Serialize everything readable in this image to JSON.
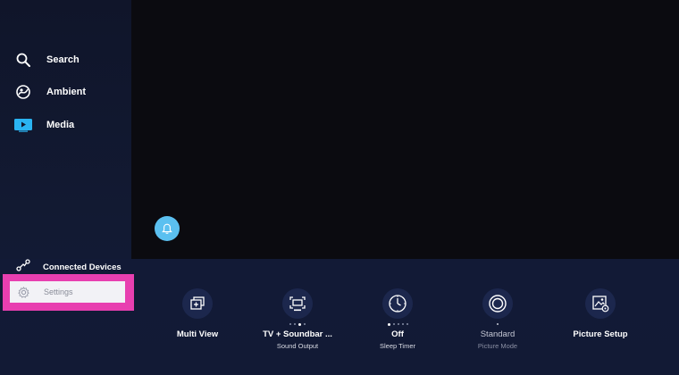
{
  "sidebar": {
    "items": [
      {
        "label": "Search",
        "icon": "search-icon"
      },
      {
        "label": "Ambient",
        "icon": "ambient-icon"
      },
      {
        "label": "Media",
        "icon": "media-icon"
      }
    ],
    "connected_devices": {
      "label": "Connected Devices",
      "icon": "connected-devices-icon"
    },
    "settings": {
      "label": "Settings",
      "icon": "gear-icon",
      "highlight_color": "#e83fb0"
    }
  },
  "notification": {
    "icon": "bell-icon",
    "color": "#5bc0f0"
  },
  "quick_settings": [
    {
      "title": "Multi View",
      "subtitle": "",
      "icon": "multi-view-icon",
      "dot_count": 0,
      "active_dot": -1
    },
    {
      "title": "TV + Soundbar ...",
      "subtitle": "Sound Output",
      "icon": "sound-output-icon",
      "dot_count": 4,
      "active_dot": 2
    },
    {
      "title": "Off",
      "subtitle": "Sleep Timer",
      "icon": "clock-icon",
      "dot_count": 5,
      "active_dot": 0
    },
    {
      "title": "Standard",
      "subtitle": "Picture Mode",
      "icon": "picture-mode-icon",
      "dot_count": 1,
      "active_dot": 0
    },
    {
      "title": "Picture Setup",
      "subtitle": "",
      "icon": "picture-setup-icon",
      "dot_count": 0,
      "active_dot": -1
    }
  ],
  "colors": {
    "media_icon": "#2ab4f2",
    "tile_circle": "#1c274d"
  }
}
